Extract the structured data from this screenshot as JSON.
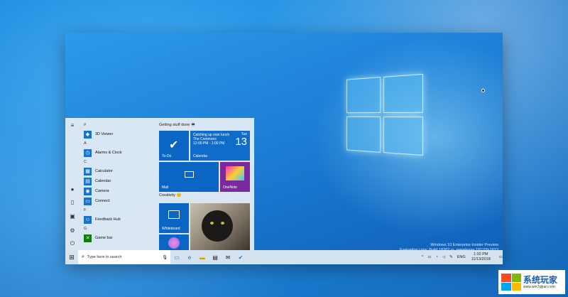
{
  "desktop": {
    "watermark_line1": "Windows 10 Enterprise Insider Preview",
    "watermark_line2": "Evaluation copy. Build 18282.rs_prerelease.181109-1613"
  },
  "start_menu": {
    "letters": [
      "#",
      "A",
      "C",
      "F",
      "G"
    ],
    "apps": [
      {
        "letter": "#",
        "name": "3D Viewer"
      },
      {
        "letter": "A",
        "name": "Alarms & Clock"
      },
      {
        "letter": "C",
        "name": "Calculator"
      },
      {
        "letter": "C",
        "name": "Calendar"
      },
      {
        "letter": "C",
        "name": "Camera"
      },
      {
        "letter": "C",
        "name": "Connect"
      },
      {
        "letter": "F",
        "name": "Feedback Hub"
      },
      {
        "letter": "G",
        "name": "Game bar"
      }
    ],
    "group1_title": "Getting stuff done 💻",
    "group2_title": "Creativity 😊",
    "tiles": {
      "todo": "To-Do",
      "calendar": "Calendar",
      "calendar_event": "Catching up over lunch",
      "calendar_location": "The Commons",
      "calendar_time": "12:00 PM - 1:00 PM",
      "calendar_day": "Tue",
      "calendar_date": "13",
      "mail": "Mail",
      "onenote": "OneNote",
      "whiteboard": "Whiteboard"
    }
  },
  "taskbar": {
    "search_placeholder": "Type here to search",
    "language": "ENG",
    "time": "1:02 PM",
    "date": "11/13/2018"
  },
  "badge": {
    "title": "系统玩家",
    "url": "www.win7qijian.com"
  },
  "colors": {
    "accent": "#0a66c2",
    "flag": [
      "#f25022",
      "#7fba00",
      "#00a4ef",
      "#ffb900"
    ]
  }
}
